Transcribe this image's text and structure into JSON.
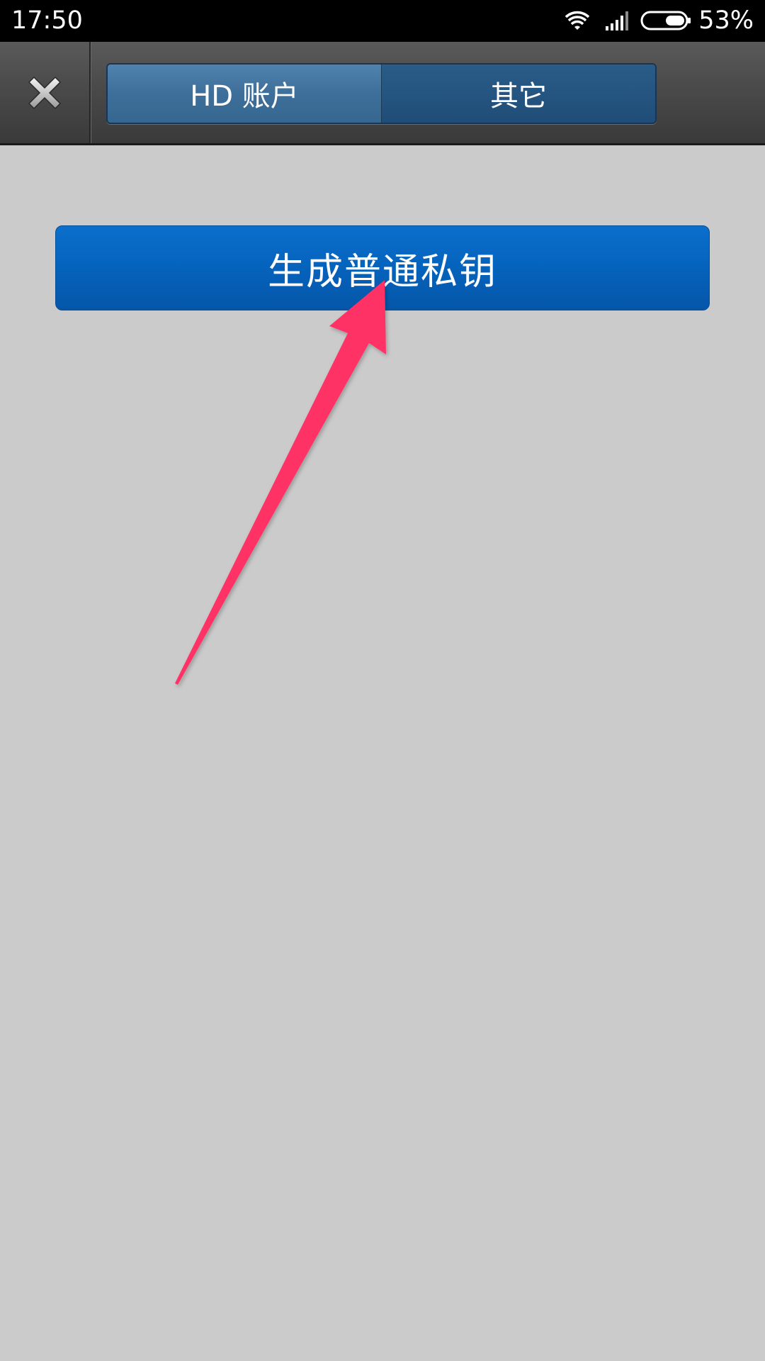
{
  "status_bar": {
    "time": "17:50",
    "battery_percent": "53%",
    "battery_level": 0.53,
    "icons": [
      "wifi-icon",
      "signal-icon",
      "battery-icon"
    ]
  },
  "header": {
    "close_icon": "close-icon",
    "tabs": [
      {
        "label": "HD 账户",
        "active": true
      },
      {
        "label": "其它",
        "active": false
      }
    ]
  },
  "main": {
    "generate_key_label": "生成普通私钥"
  },
  "colors": {
    "background": "#cbcbcb",
    "primary_button": "#0564be",
    "active_tab": "#3d6f9a",
    "inactive_tab": "#1f4d78",
    "annotation_arrow": "#ff3366"
  }
}
